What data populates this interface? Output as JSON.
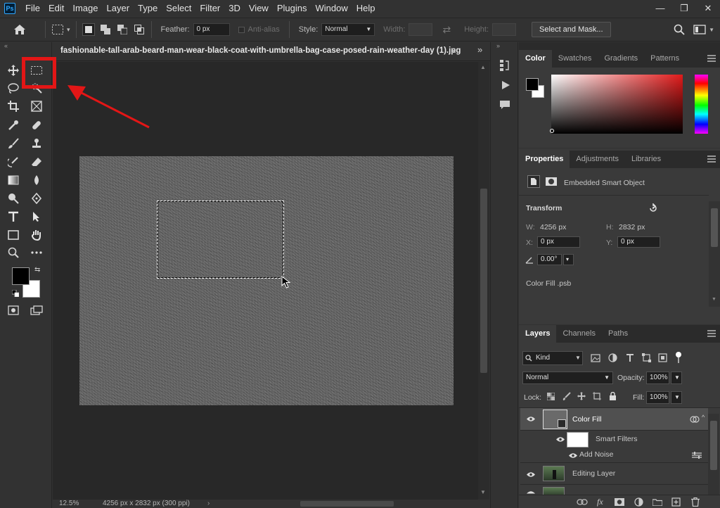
{
  "app": {
    "logo": "Ps"
  },
  "menu": [
    "File",
    "Edit",
    "Image",
    "Layer",
    "Type",
    "Select",
    "Filter",
    "3D",
    "View",
    "Plugins",
    "Window",
    "Help"
  ],
  "window_controls": {
    "minimize": "—",
    "restore": "❐",
    "close": "✕"
  },
  "options": {
    "feather_label": "Feather:",
    "feather_value": "0 px",
    "antialias_label": "Anti-alias",
    "style_label": "Style:",
    "style_value": "Normal",
    "width_label": "Width:",
    "height_label": "Height:",
    "select_mask_label": "Select and Mask..."
  },
  "document": {
    "tab_title": "fashionable-tall-arab-beard-man-wear-black-coat-with-umbrella-bag-case-posed-rain-weather-day (1).jpg",
    "tab_close": "×"
  },
  "status": {
    "zoom": "12.5%",
    "info": "4256 px x 2832 px (300 ppi)"
  },
  "color_panel": {
    "tabs": [
      "Color",
      "Swatches",
      "Gradients",
      "Patterns"
    ],
    "foreground": "#000000",
    "background": "#ffffff",
    "hue": "#e11a1a"
  },
  "properties_panel": {
    "tabs": [
      "Properties",
      "Adjustments",
      "Libraries"
    ],
    "type_label": "Embedded Smart Object",
    "transform_title": "Transform",
    "w_label": "W:",
    "w_value": "4256 px",
    "h_label": "H:",
    "h_value": "2832 px",
    "x_label": "X:",
    "x_value": "0 px",
    "y_label": "Y:",
    "y_value": "0 px",
    "angle_value": "0.00°",
    "source_file": "Color Fill .psb"
  },
  "layers_panel": {
    "tabs": [
      "Layers",
      "Channels",
      "Paths"
    ],
    "filter_kind": "Kind",
    "blend_mode": "Normal",
    "opacity_label": "Opacity:",
    "opacity_value": "100%",
    "lock_label": "Lock:",
    "fill_label": "Fill:",
    "fill_value": "100%",
    "layers": {
      "color_fill": "Color Fill",
      "smart_filters": "Smart Filters",
      "add_noise": "Add Noise",
      "editing_layer": "Editing Layer"
    }
  },
  "annotation": {
    "highlight_color": "#e31616"
  }
}
